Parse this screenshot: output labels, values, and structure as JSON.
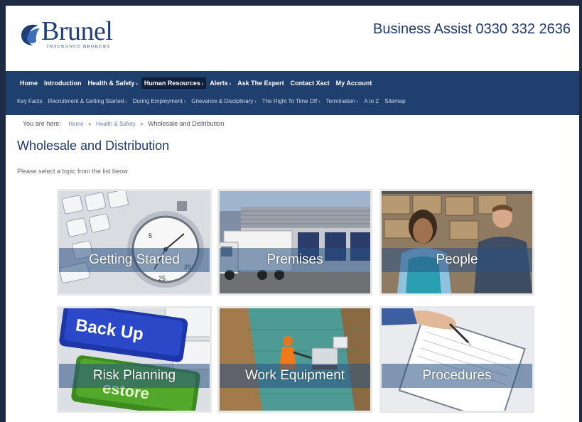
{
  "brand": {
    "name": "Brunel",
    "tagline": "INSURANCE BROKERS"
  },
  "header": {
    "phone_text": "Business Assist 0330 332 2636"
  },
  "nav_primary": [
    {
      "label": "Home"
    },
    {
      "label": "Introduction"
    },
    {
      "label": "Health & Safety"
    },
    {
      "label": "Human Resources"
    },
    {
      "label": "Alerts"
    },
    {
      "label": "Ask The Expert"
    },
    {
      "label": "Contact Xact"
    },
    {
      "label": "My Account"
    }
  ],
  "nav_secondary": [
    {
      "label": "Key Facts"
    },
    {
      "label": "Recruitment & Getting Started"
    },
    {
      "label": "During Employment"
    },
    {
      "label": "Grievance & Disciplinary"
    },
    {
      "label": "The Right To Time Off"
    },
    {
      "label": "Termination"
    },
    {
      "label": "A to Z"
    },
    {
      "label": "Sitemap"
    }
  ],
  "breadcrumb": {
    "prefix": "You are here:",
    "items": [
      "Home",
      "Health & Safety",
      "Wholesale and Distribution"
    ],
    "sep": "»"
  },
  "page": {
    "title": "Wholesale and Distribution",
    "intro": "Please select a topic from the list beow"
  },
  "tiles": [
    {
      "label": "Getting Started"
    },
    {
      "label": "Premises"
    },
    {
      "label": "People"
    },
    {
      "label": "Risk Planning"
    },
    {
      "label": "Work Equipment"
    },
    {
      "label": "Procedures"
    }
  ],
  "colors": {
    "nav_bg": "#1f3f6e",
    "brand": "#1f3f7a",
    "frame": "#1f2a44"
  }
}
